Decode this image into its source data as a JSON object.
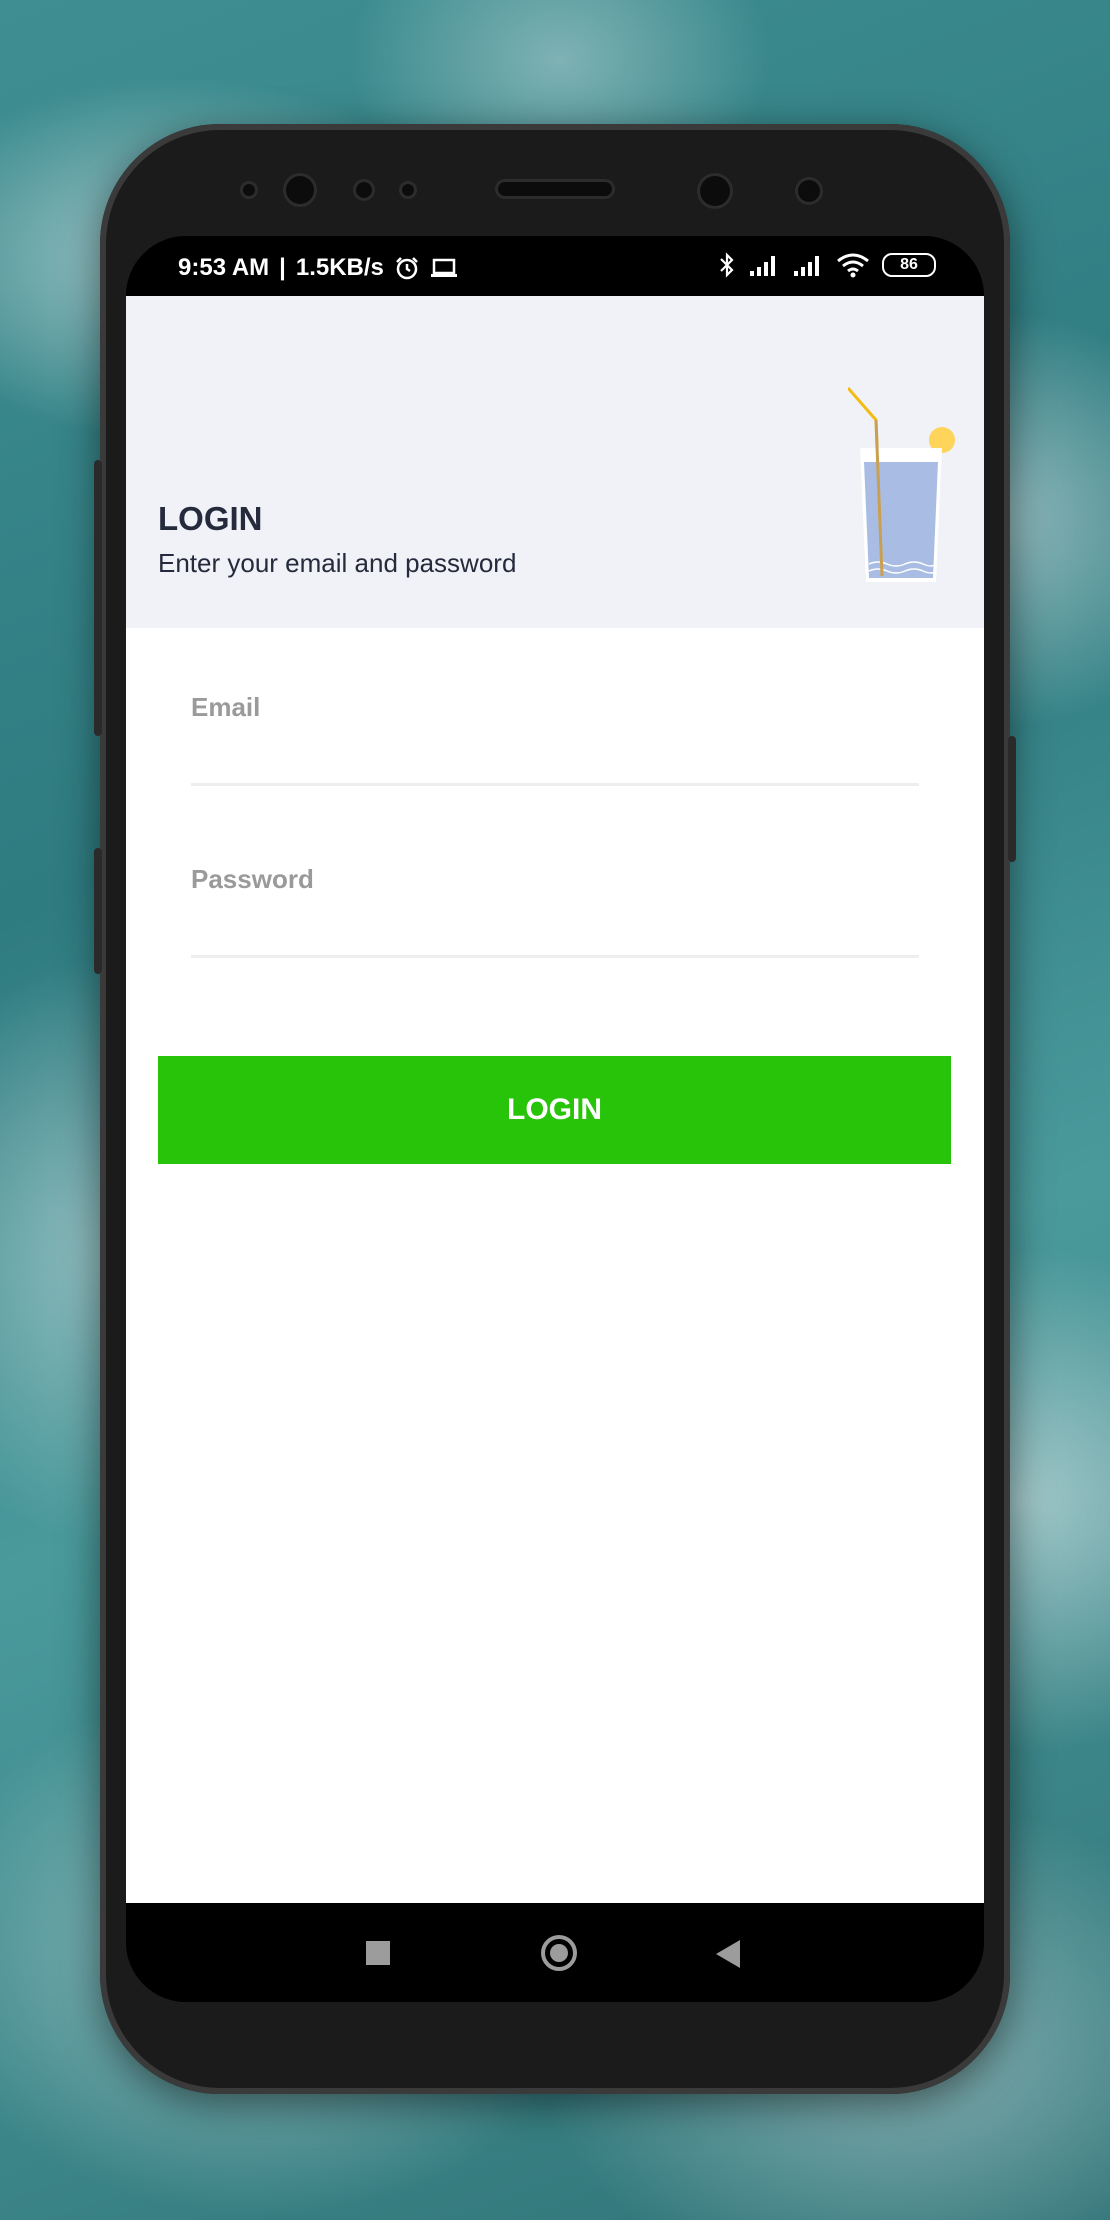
{
  "status_bar": {
    "time": "9:53 AM",
    "separator": "|",
    "speed": "1.5KB/s",
    "icons": [
      "alarm-icon",
      "laptop-icon",
      "bluetooth-icon",
      "signal-icon",
      "signal-icon",
      "wifi-icon"
    ],
    "battery": "86"
  },
  "header": {
    "title": "LOGIN",
    "subtitle": "Enter your email and password",
    "illustration": "drink-glass-illustration"
  },
  "form": {
    "email_label": "Email",
    "email_value": "",
    "password_label": "Password",
    "password_value": "",
    "submit_label": "LOGIN"
  },
  "colors": {
    "accent": "#28c40a",
    "header_bg": "#f1f2f7",
    "title_text": "#252a3c",
    "label_text": "#9a9a9a"
  },
  "nav_bar": {
    "icons": [
      "recents-icon",
      "home-icon",
      "back-icon"
    ]
  }
}
